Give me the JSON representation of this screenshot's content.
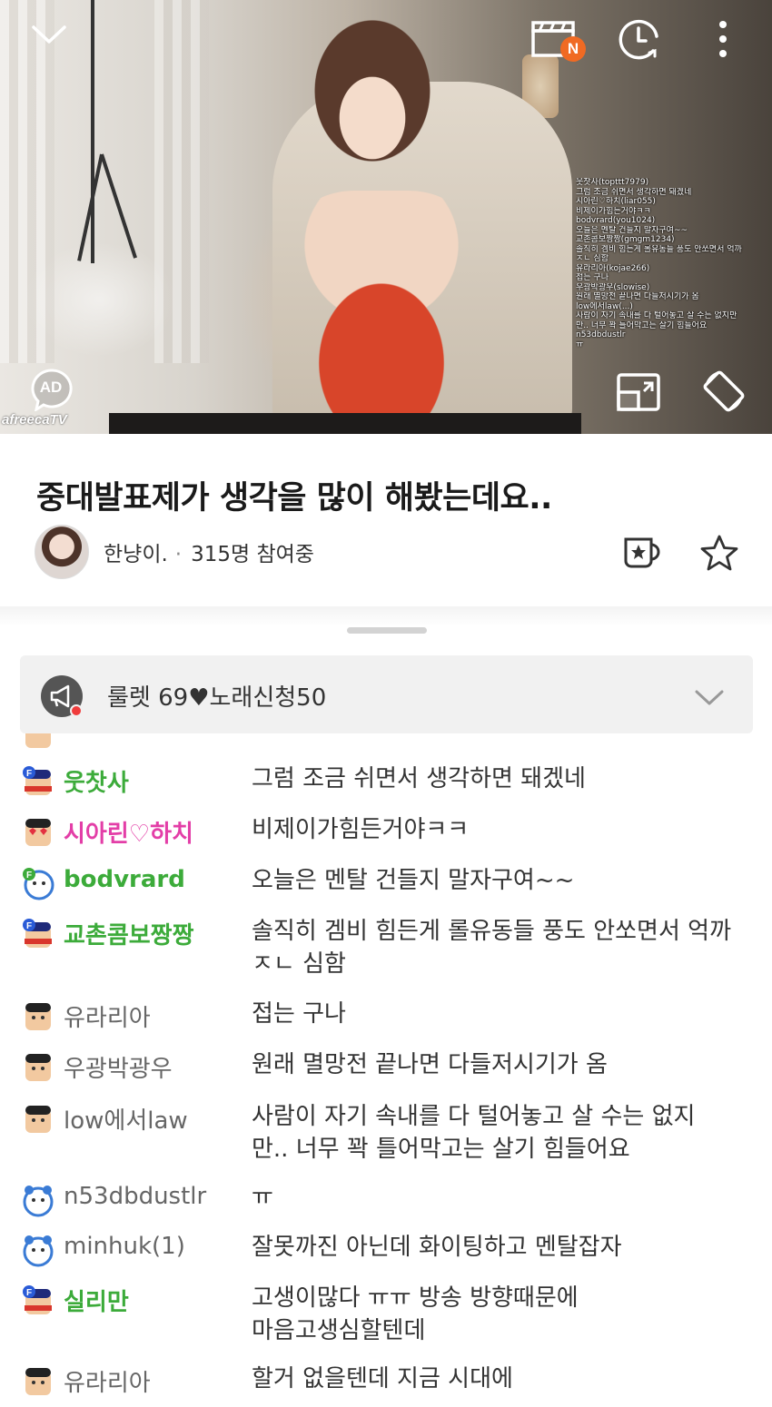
{
  "video": {
    "watermark": "afreecaTV",
    "ad_label": "AD",
    "new_badge": "N",
    "overlay_chat": [
      "웃찻사(topttt7979)",
      "그럼 조금 쉬면서 생각하면 돼겠네",
      "시아린♡하치(liar055)",
      "비제이가힘든거야ㅋㅋ",
      "bodvrard(you1024)",
      "오늘은 멘탈 건들지 말자구여~~",
      "교촌콤보짱짱(gmgm1234)",
      "솔직히 겜비 힘든게 롤유동들 풍도 안쏘면서 억까",
      "ㅈㄴ 심함",
      "유라리아(kojae266)",
      "접는 구나",
      "우광박광우(slowise)",
      "원래 멸망전 끝나면 다들저시기가 옴",
      "low에서law(...)",
      "사람이 자기 속내를 다 털어놓고 살 수는 없지만",
      "만.. 너무 꽉 틀어막고는 살기 힘들어요",
      "n53dbdustlr",
      "ㅠ"
    ]
  },
  "broadcast": {
    "title": "중대발표제가 생각을 많이 해봤는데요..",
    "streamer": "한냥이.",
    "separator": "·",
    "viewers": "315명 참여중"
  },
  "notice": {
    "text": "룰렛 69♥노래신청50"
  },
  "chat": [
    {
      "nick": "웃찻사",
      "msg": "그럼 조금 쉬면서 생각하면 돼겠네",
      "style": "green",
      "icon": "fan-badge-icon"
    },
    {
      "nick": "시아린♡하치",
      "msg": "비제이가힘든거야ㅋㅋ",
      "style": "pink",
      "icon": "heart-eyes-icon"
    },
    {
      "nick": "bodvrard",
      "msg": "오늘은 멘탈 건들지 말자구여~~",
      "style": "teal",
      "icon": "fan-bear-icon"
    },
    {
      "nick": "교촌콤보짱짱",
      "msg": "솔직히 겜비 힘든게 롤유동들 풍도 안쏘면서 억까 ㅈㄴ 심함",
      "style": "green",
      "icon": "fan-badge-icon"
    },
    {
      "nick": "유라리아",
      "msg": "접는 구나",
      "style": "gray",
      "icon": "user-face-icon"
    },
    {
      "nick": "우광박광우",
      "msg": "원래 멸망전 끝나면 다들저시기가 옴",
      "style": "gray",
      "icon": "user-face-icon"
    },
    {
      "nick": "low에서law",
      "msg": "사람이 자기 속내를 다 털어놓고 살 수는 없지만.. 너무 꽉 틀어막고는 살기 힘들어요",
      "style": "gray",
      "icon": "user-face-icon"
    },
    {
      "nick": "n53dbdustlr",
      "msg": "ㅠ",
      "style": "gray",
      "icon": "bear-face-icon"
    },
    {
      "nick": "minhuk(1)",
      "msg": "잘못까진 아닌데 화이팅하고 멘탈잡자",
      "style": "gray",
      "icon": "bear-face-icon"
    },
    {
      "nick": "실리만",
      "msg": "고생이많다 ㅠㅠ 방송 방향때문에 마음고생심할텐데",
      "style": "green",
      "icon": "fan-badge-icon"
    },
    {
      "nick": "유라리아",
      "msg": "할거 없을텐데 지금 시대에",
      "style": "gray",
      "icon": "user-face-icon"
    }
  ]
}
